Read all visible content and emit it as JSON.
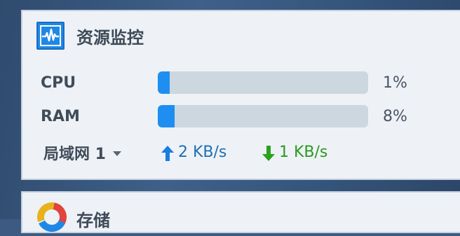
{
  "resource_monitor": {
    "title": "资源监控",
    "metrics": [
      {
        "label": "CPU",
        "value_text": "1%",
        "fraction": 0.01
      },
      {
        "label": "RAM",
        "value_text": "8%",
        "fraction": 0.08
      }
    ],
    "network": {
      "selector_label": "局域网 1",
      "upload": "2 KB/s",
      "download": "1 KB/s"
    }
  },
  "storage": {
    "title": "存储"
  },
  "colors": {
    "accent": "#1e8ff0",
    "upload": "#1f6fb0",
    "download": "#2b9a1f",
    "panel_bg": "#eef2f7",
    "bar_track": "#cdd7e0"
  },
  "icons": {
    "monitor": "activity-monitor-icon",
    "upload": "arrow-up-icon",
    "download": "arrow-down-icon",
    "dropdown": "caret-down-icon",
    "storage": "storage-donut-icon"
  }
}
